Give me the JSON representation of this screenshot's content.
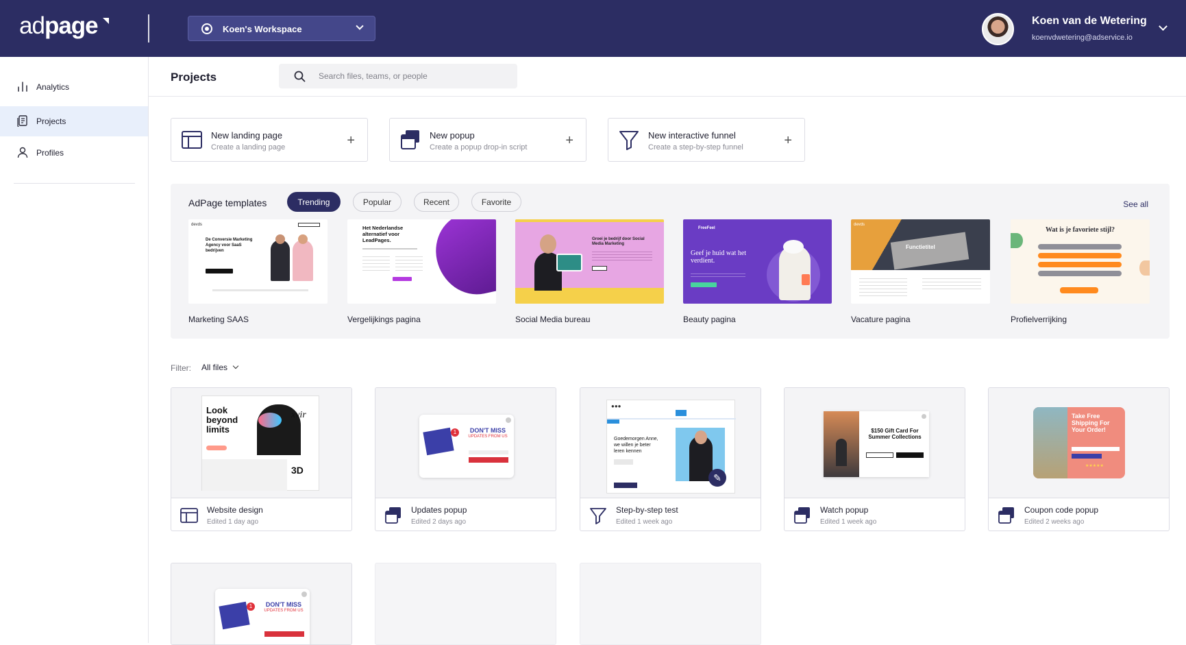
{
  "brand": {
    "logo_light": "ad",
    "logo_bold": "page",
    "primary_color": "#2c2d63",
    "accent_color": "#e8effb"
  },
  "workspace": {
    "name": "Koen's Workspace"
  },
  "user": {
    "name": "Koen van de Wetering",
    "email": "koenvdwetering@adservice.io"
  },
  "sidebar": {
    "items": [
      {
        "label": "Analytics",
        "icon": "bar-chart-icon"
      },
      {
        "label": "Projects",
        "icon": "document-icon",
        "active": true
      },
      {
        "label": "Profiles",
        "icon": "user-icon"
      }
    ]
  },
  "main": {
    "title": "Projects",
    "search_placeholder": "Search files, teams, or people"
  },
  "create": [
    {
      "title": "New landing page",
      "subtitle": "Create a landing page",
      "icon": "layout-icon"
    },
    {
      "title": "New popup",
      "subtitle": "Create a popup drop-in script",
      "icon": "popup-icon"
    },
    {
      "title": "New interactive funnel",
      "subtitle": "Create a step-by-step funnel",
      "icon": "funnel-icon"
    }
  ],
  "templates": {
    "title": "AdPage templates",
    "tabs": [
      "Trending",
      "Popular",
      "Recent",
      "Favorite"
    ],
    "active_tab": "Trending",
    "see_all": "See all",
    "items": [
      {
        "name": "Marketing SAAS",
        "headline": "De Conversie Marketing Agency voor SaaS bedrijven",
        "brand": "devds"
      },
      {
        "name": "Vergelijkings pagina",
        "headline": "Het Nederlandse alternatief voor LeadPages."
      },
      {
        "name": "Social Media bureau",
        "headline": "Groei je bedrijf door Social Media Marketing"
      },
      {
        "name": "Beauty pagina",
        "headline": "Geef je huid wat het verdient.",
        "brand": "FreeFeel"
      },
      {
        "name": "Vacature pagina",
        "headline": "Functietitel",
        "brand": "devds"
      },
      {
        "name": "Profielverrijking",
        "headline": "Wat is je favoriete stijl?"
      }
    ]
  },
  "filter": {
    "label": "Filter:",
    "value": "All files"
  },
  "files": [
    {
      "name": "Website design",
      "edited": "Edited 1 day ago",
      "icon": "layout-icon",
      "preview_text": "Look beyond limits"
    },
    {
      "name": "Updates popup",
      "edited": "Edited 2 days ago",
      "icon": "popup-icon",
      "preview_text": "DON'T MISS",
      "preview_sub": "UPDATES FROM US"
    },
    {
      "name": "Step-by-step test",
      "edited": "Edited 1 week ago",
      "icon": "funnel-icon",
      "preview_text": "Goedemorgen Anne, we willen je beter leren kennen"
    },
    {
      "name": "Watch popup",
      "edited": "Edited 1 week ago",
      "icon": "popup-icon",
      "preview_text": "$150 Gift Card For Summer Collections"
    },
    {
      "name": "Coupon code popup",
      "edited": "Edited 2 weeks ago",
      "icon": "popup-icon",
      "preview_text": "Take Free Shipping For Your Order!"
    }
  ],
  "more_files": [
    {
      "preview_text": "DON'T MISS",
      "preview_sub": "UPDATES FROM US"
    }
  ]
}
